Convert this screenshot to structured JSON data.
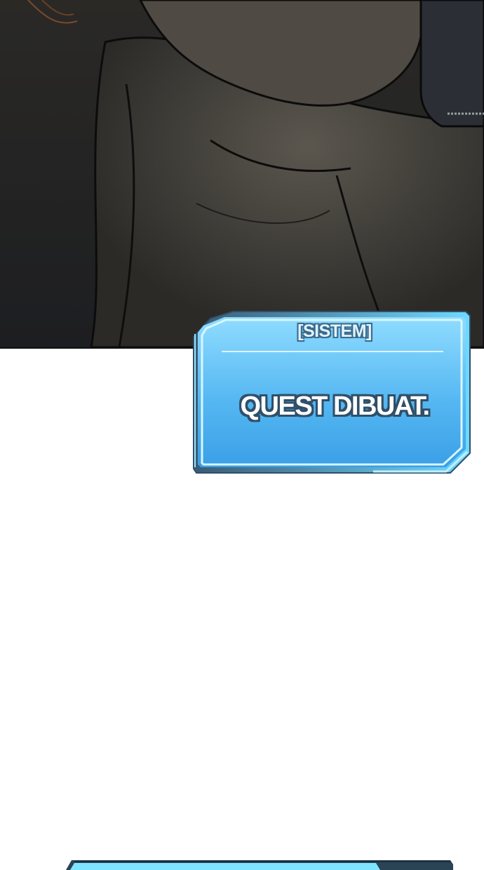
{
  "panel": {
    "scene": "dark-illustrated-panel",
    "colors": {
      "shadow": "#1e1f22",
      "mid": "#3a3835",
      "highlight": "#6b665d"
    }
  },
  "system_window": {
    "header": "[SISTEM]",
    "message": "QUEST DIBUAT.",
    "colors": {
      "fill_top": "#7fd3ff",
      "fill_bottom": "#3a9fe6",
      "border": "#bff0ff",
      "outline": "#2f4f6a"
    }
  },
  "next_window": {
    "colors": {
      "fill": "#7fe4ff",
      "dark": "#2a4456"
    }
  }
}
